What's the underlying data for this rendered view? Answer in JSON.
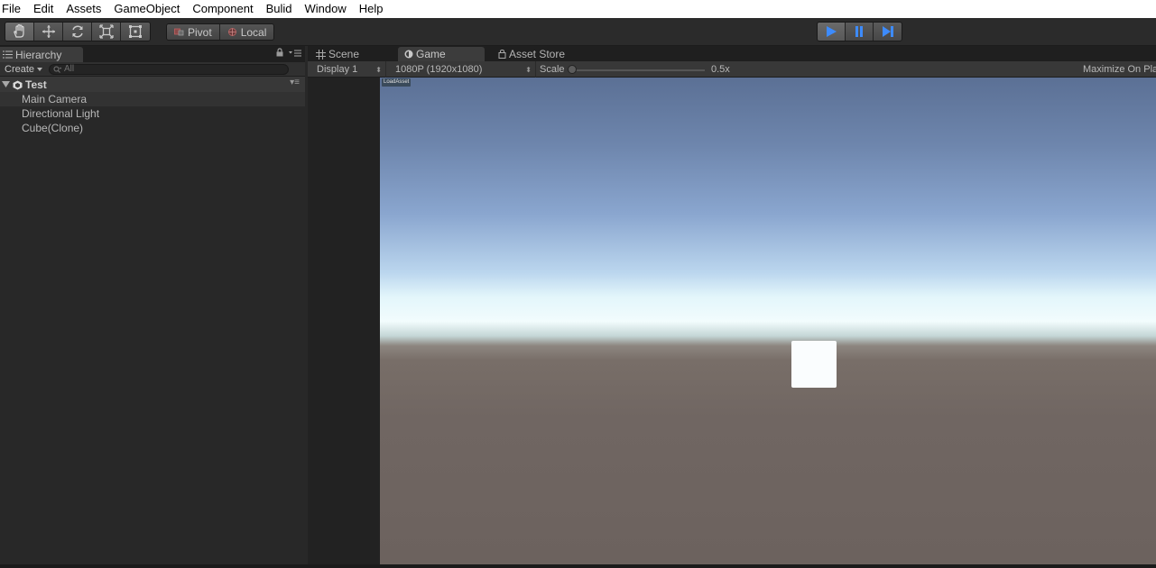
{
  "menubar": {
    "items": [
      "File",
      "Edit",
      "Assets",
      "GameObject",
      "Component",
      "Bulid",
      "Window",
      "Help"
    ]
  },
  "toolbar": {
    "tools": [
      "hand-tool-icon",
      "move-tool-icon",
      "rotate-tool-icon",
      "scale-tool-icon",
      "rect-tool-icon"
    ],
    "pivot_label": "Pivot",
    "local_label": "Local",
    "play_controls": [
      "play-icon",
      "pause-icon",
      "step-icon"
    ],
    "accent_color": "#3d8bfd"
  },
  "hierarchy": {
    "tab_label": "Hierarchy",
    "create_label": "Create",
    "search_placeholder": "All",
    "scene_name": "Test",
    "items": [
      "Main Camera",
      "Directional Light",
      "Cube(Clone)"
    ]
  },
  "view": {
    "tabs": [
      "Scene",
      "Game",
      "Asset Store"
    ],
    "active_tab": "Game",
    "display_label": "Display 1",
    "resolution_label": "1080P (1920x1080)",
    "scale_label": "Scale",
    "scale_value": "0.5x",
    "maximize_label": "Maximize On Play",
    "load_badge": "LoadAsset"
  }
}
